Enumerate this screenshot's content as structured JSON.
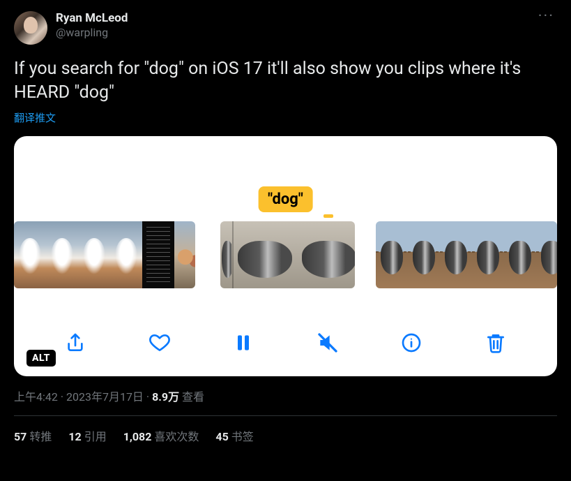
{
  "author": {
    "display_name": "Ryan McLeod",
    "handle": "@warpling"
  },
  "more_glyph": "···",
  "tweet_text": "If you search for \"dog\" on iOS 17 it'll also show you clips where it's HEARD \"dog\"",
  "translate_label": "翻译推文",
  "media": {
    "search_bubble": "\"dog\"",
    "alt_badge": "ALT",
    "toolbar_icons": {
      "share": "share-icon",
      "like": "heart-icon",
      "pause": "pause-icon",
      "mute": "speaker-muted-icon",
      "info": "info-icon",
      "delete": "trash-icon"
    }
  },
  "meta": {
    "time": "上午4:42",
    "sep1": " · ",
    "date": "2023年7月17日",
    "sep2": " · ",
    "views_count": "8.9万",
    "views_label": " 查看"
  },
  "stats": {
    "retweets": {
      "count": "57",
      "label": "转推"
    },
    "quotes": {
      "count": "12",
      "label": "引用"
    },
    "likes": {
      "count": "1,082",
      "label": "喜欢次数"
    },
    "bookmarks": {
      "count": "45",
      "label": "书签"
    }
  }
}
